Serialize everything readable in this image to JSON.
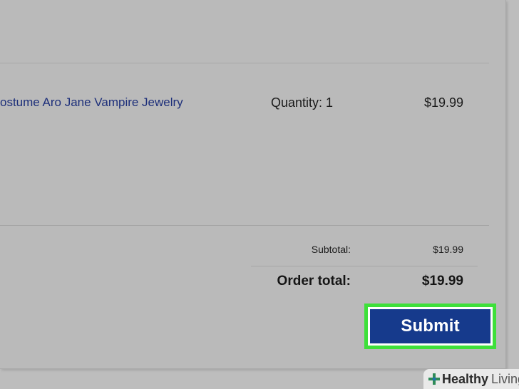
{
  "order": {
    "item": {
      "name": "ostume Aro Jane Vampire Jewelry",
      "quantity_text": "Quantity: 1",
      "price": "$19.99"
    },
    "summary": {
      "subtotal_label": "Subtotal:",
      "subtotal_value": "$19.99",
      "total_label": "Order total:",
      "total_value": "$19.99"
    },
    "submit_label": "Submit"
  },
  "watermark": {
    "bold": "Healthy",
    "light": "Living",
    "icon": "plus-icon"
  },
  "colors": {
    "submit_button": "#163a8c",
    "highlight": "#3ee03a",
    "link": "#1d2f7a"
  }
}
